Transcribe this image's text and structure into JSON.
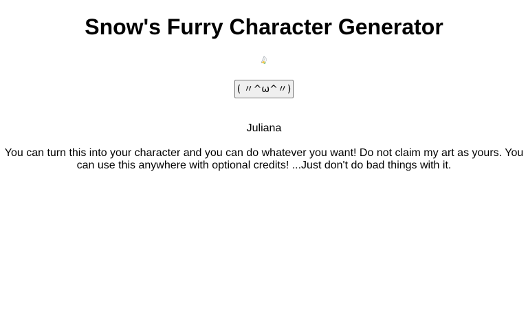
{
  "page": {
    "title": "Snow's Furry Character Generator"
  },
  "character": {
    "image_icon": "broken-image-icon",
    "name": "Juliana"
  },
  "generate_button": {
    "label": "( 〃^ω^〃)"
  },
  "disclaimer": {
    "text": "You can turn this into your character and you can do whatever you want! Do not claim my art as yours. You can use this anywhere with optional credits! ...Just don't do bad things with it."
  }
}
